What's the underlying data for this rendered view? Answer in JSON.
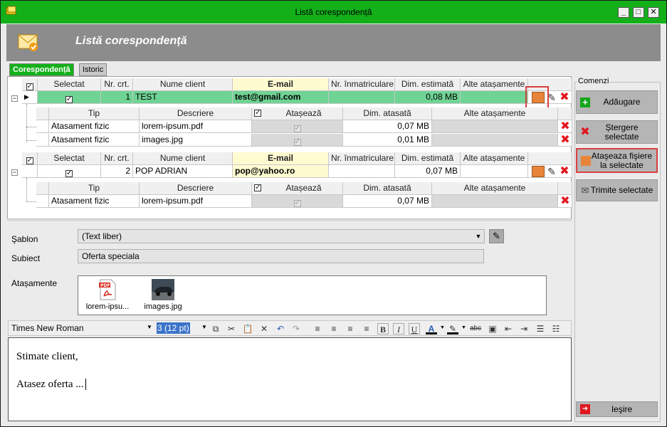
{
  "window": {
    "title": "Listă corespondență"
  },
  "header": {
    "title": "Listă corespondență"
  },
  "tabs": [
    {
      "label": "Corespondență"
    },
    {
      "label": "Istoric"
    }
  ],
  "grid": {
    "columns": [
      "Selectat",
      "Nr. crt.",
      "Nume client",
      "E-mail",
      "Nr. înmatriculare",
      "Dim. estimată",
      "Alte atașamente"
    ],
    "detail_columns": [
      "Tip",
      "Descriere",
      "Atașează",
      "Dim. atasată",
      "Alte atașamente"
    ],
    "rows": [
      {
        "nr": "1",
        "client": "TEST",
        "email": "test@gmail.com",
        "plate": "",
        "size": "0,08 MB",
        "attachments": [
          {
            "type": "Atasament fizic",
            "desc": "lorem-ipsum.pdf",
            "size": "0,07 MB"
          },
          {
            "type": "Atasament fizic",
            "desc": "images.jpg",
            "size": "0,01 MB"
          }
        ]
      },
      {
        "nr": "2",
        "client": "POP ADRIAN",
        "email": "pop@yahoo.ro",
        "plate": "",
        "size": "0,07 MB",
        "attachments": [
          {
            "type": "Atasament fizic",
            "desc": "lorem-ipsum.pdf",
            "size": "0,07 MB"
          }
        ]
      }
    ]
  },
  "sidebar": {
    "legend": "Comenzi",
    "buttons": {
      "add": "Adăugare",
      "delete_line1": "Ștergere",
      "delete_line2": "selectate",
      "attach_line1": "Ataşeaza fişiere",
      "attach_line2": "la selectate",
      "send": "Trimite selectate",
      "exit": "Ieşire"
    }
  },
  "form": {
    "template_label": "Şablon",
    "template_value": "(Text liber)",
    "subject_label": "Subiect",
    "subject_value": "Oferta speciala",
    "attachments_label": "Atașamente",
    "attachment_files": [
      "lorem-ipsu...",
      "images.jpg"
    ]
  },
  "editor": {
    "font": "Times New Roman",
    "size": "3 (12 pt)",
    "line1": "Stimate client,",
    "line2": "Atasez oferta ..."
  },
  "colors": {
    "accent": "#13b01a",
    "selected_row": "#6fd394",
    "email_bg": "#fffbd1",
    "delete": "#e1171f",
    "highlight": "#d9403f"
  }
}
